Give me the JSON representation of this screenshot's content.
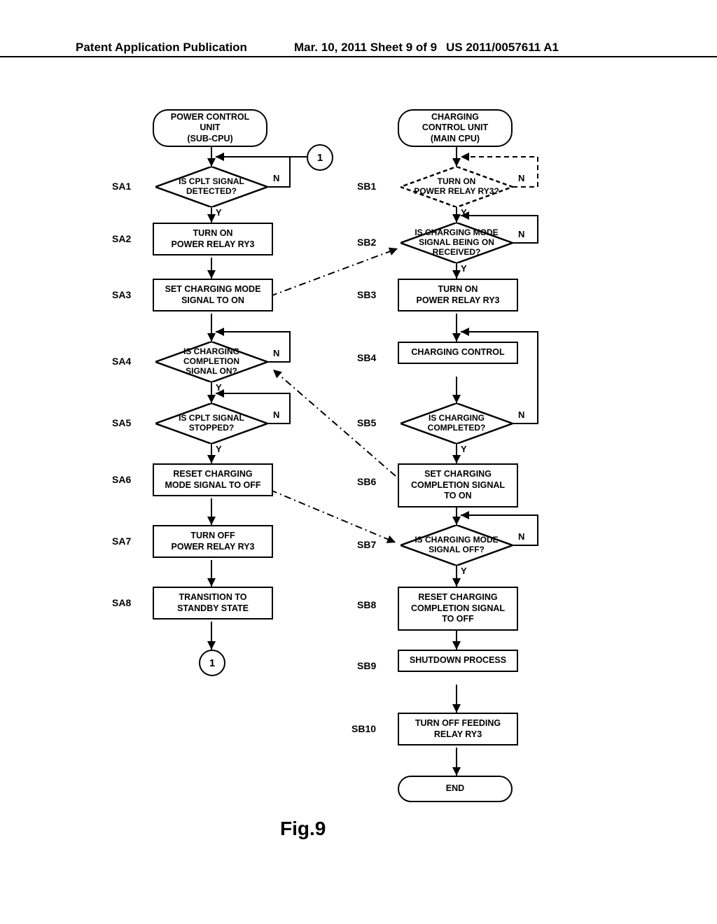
{
  "header": {
    "left": "Patent Application Publication",
    "mid": "Mar. 10, 2011  Sheet 9 of 9",
    "right": "US 2011/0057611 A1"
  },
  "figureLabel": "Fig.9",
  "left": {
    "title": "POWER CONTROL\nUNIT\n(SUB-CPU)",
    "steps": {
      "SA1": {
        "label": "SA1",
        "text": "IS CPLT SIGNAL DETECTED?",
        "type": "decision"
      },
      "SA2": {
        "label": "SA2",
        "text": "TURN ON\nPOWER RELAY RY3",
        "type": "process"
      },
      "SA3": {
        "label": "SA3",
        "text": "SET CHARGING MODE\nSIGNAL TO ON",
        "type": "process"
      },
      "SA4": {
        "label": "SA4",
        "text": "IS CHARGING COMPLETION SIGNAL ON?",
        "type": "decision"
      },
      "SA5": {
        "label": "SA5",
        "text": "IS CPLT SIGNAL STOPPED?",
        "type": "decision"
      },
      "SA6": {
        "label": "SA6",
        "text": "RESET CHARGING\nMODE SIGNAL TO OFF",
        "type": "process"
      },
      "SA7": {
        "label": "SA7",
        "text": "TURN OFF\nPOWER RELAY RY3",
        "type": "process"
      },
      "SA8": {
        "label": "SA8",
        "text": "TRANSITION TO\nSTANDBY STATE",
        "type": "process"
      }
    },
    "connector": "1"
  },
  "right": {
    "title": "CHARGING\nCONTROL UNIT\n(MAIN CPU)",
    "steps": {
      "SB1": {
        "label": "SB1",
        "text": "TURN ON\nPOWER RELAY RY3?",
        "type": "decision_dashed"
      },
      "SB2": {
        "label": "SB2",
        "text": "IS CHARGING MODE SIGNAL BEING ON RECEIVED?",
        "type": "decision"
      },
      "SB3": {
        "label": "SB3",
        "text": "TURN ON\nPOWER RELAY RY3",
        "type": "process"
      },
      "SB4": {
        "label": "SB4",
        "text": "CHARGING CONTROL",
        "type": "process"
      },
      "SB5": {
        "label": "SB5",
        "text": "IS CHARGING COMPLETED?",
        "type": "decision"
      },
      "SB6": {
        "label": "SB6",
        "text": "SET CHARGING\nCOMPLETION SIGNAL\nTO ON",
        "type": "process"
      },
      "SB7": {
        "label": "SB7",
        "text": "IS CHARGING MODE SIGNAL OFF?",
        "type": "decision"
      },
      "SB8": {
        "label": "SB8",
        "text": "RESET CHARGING\nCOMPLETION SIGNAL\nTO OFF",
        "type": "process"
      },
      "SB9": {
        "label": "SB9",
        "text": "SHUTDOWN PROCESS",
        "type": "process"
      },
      "SB10": {
        "label": "SB10",
        "text": "TURN OFF FEEDING\nRELAY RY3",
        "type": "process"
      }
    },
    "end": "END"
  },
  "labels": {
    "yes": "Y",
    "no": "N"
  },
  "connectorTop": "1"
}
